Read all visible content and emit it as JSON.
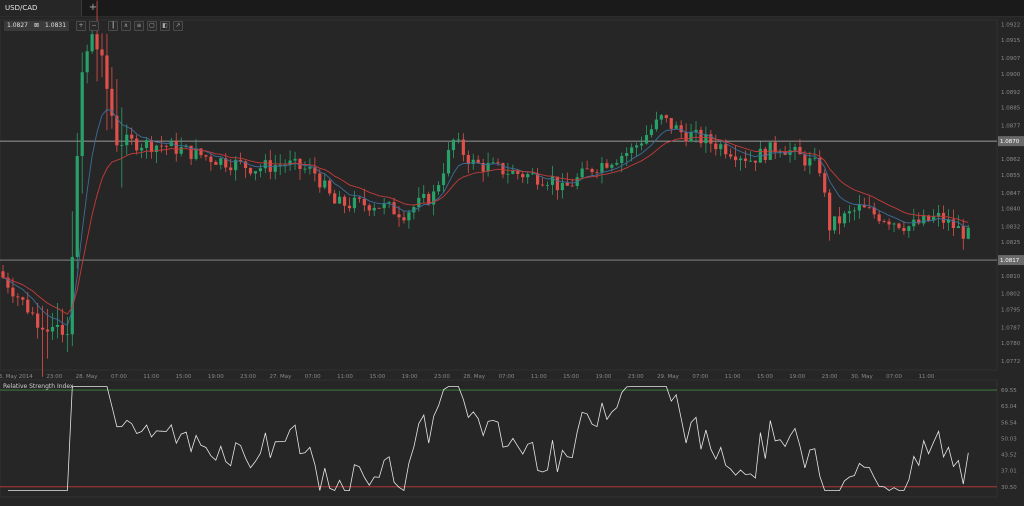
{
  "tab": {
    "symbol": "USD/CAD",
    "add_label": "+"
  },
  "price_box": {
    "bid": "1.0827",
    "separator": "⊠",
    "ask": "1.0831"
  },
  "toolbar": {
    "icons": [
      "zoom-in-icon",
      "zoom-out-icon",
      "candlestick-icon",
      "indicator-icon",
      "list-icon",
      "drawing-icon",
      "template-icon",
      "crosshair-icon"
    ]
  },
  "main_chart": {
    "y_ticks": [
      "1.0922",
      "1.0915",
      "1.0907",
      "1.0900",
      "1.0892",
      "1.0885",
      "1.0877",
      "1.0870",
      "1.0862",
      "1.0855",
      "1.0847",
      "1.0840",
      "1.0832",
      "1.0825",
      "1.0810",
      "1.0802",
      "1.0795",
      "1.0787",
      "1.0780",
      "1.0772"
    ],
    "x_ticks": [
      "23. May 2014",
      "23:00",
      "28. May",
      "07:00",
      "11:00",
      "15:00",
      "19:00",
      "23:00",
      "27. May",
      "07:00",
      "11:00",
      "15:00",
      "19:00",
      "23:00",
      "28. May",
      "07:00",
      "11:00",
      "15:00",
      "19:00",
      "23:00",
      "29. May",
      "07:00",
      "11:00",
      "15:00",
      "19:00",
      "23:00",
      "30. May",
      "07:00",
      "11:00"
    ],
    "level_upper": "1.0870",
    "level_lower": "1.0817"
  },
  "rsi": {
    "title": "Relative Strength Index",
    "y_ticks": [
      "69.55",
      "63.04",
      "56.54",
      "50.03",
      "43.52",
      "37.01",
      "30.50"
    ]
  },
  "colors": {
    "up": "#26a269",
    "down": "#e0504a",
    "ma_blue": "#3d6d99",
    "ma_red": "#c43b3b",
    "rsi_line": "#e6e6e6",
    "rsi_upper": "#3e8a3e",
    "rsi_lower": "#c43b3b",
    "level_line": "#bdbdbd"
  }
}
